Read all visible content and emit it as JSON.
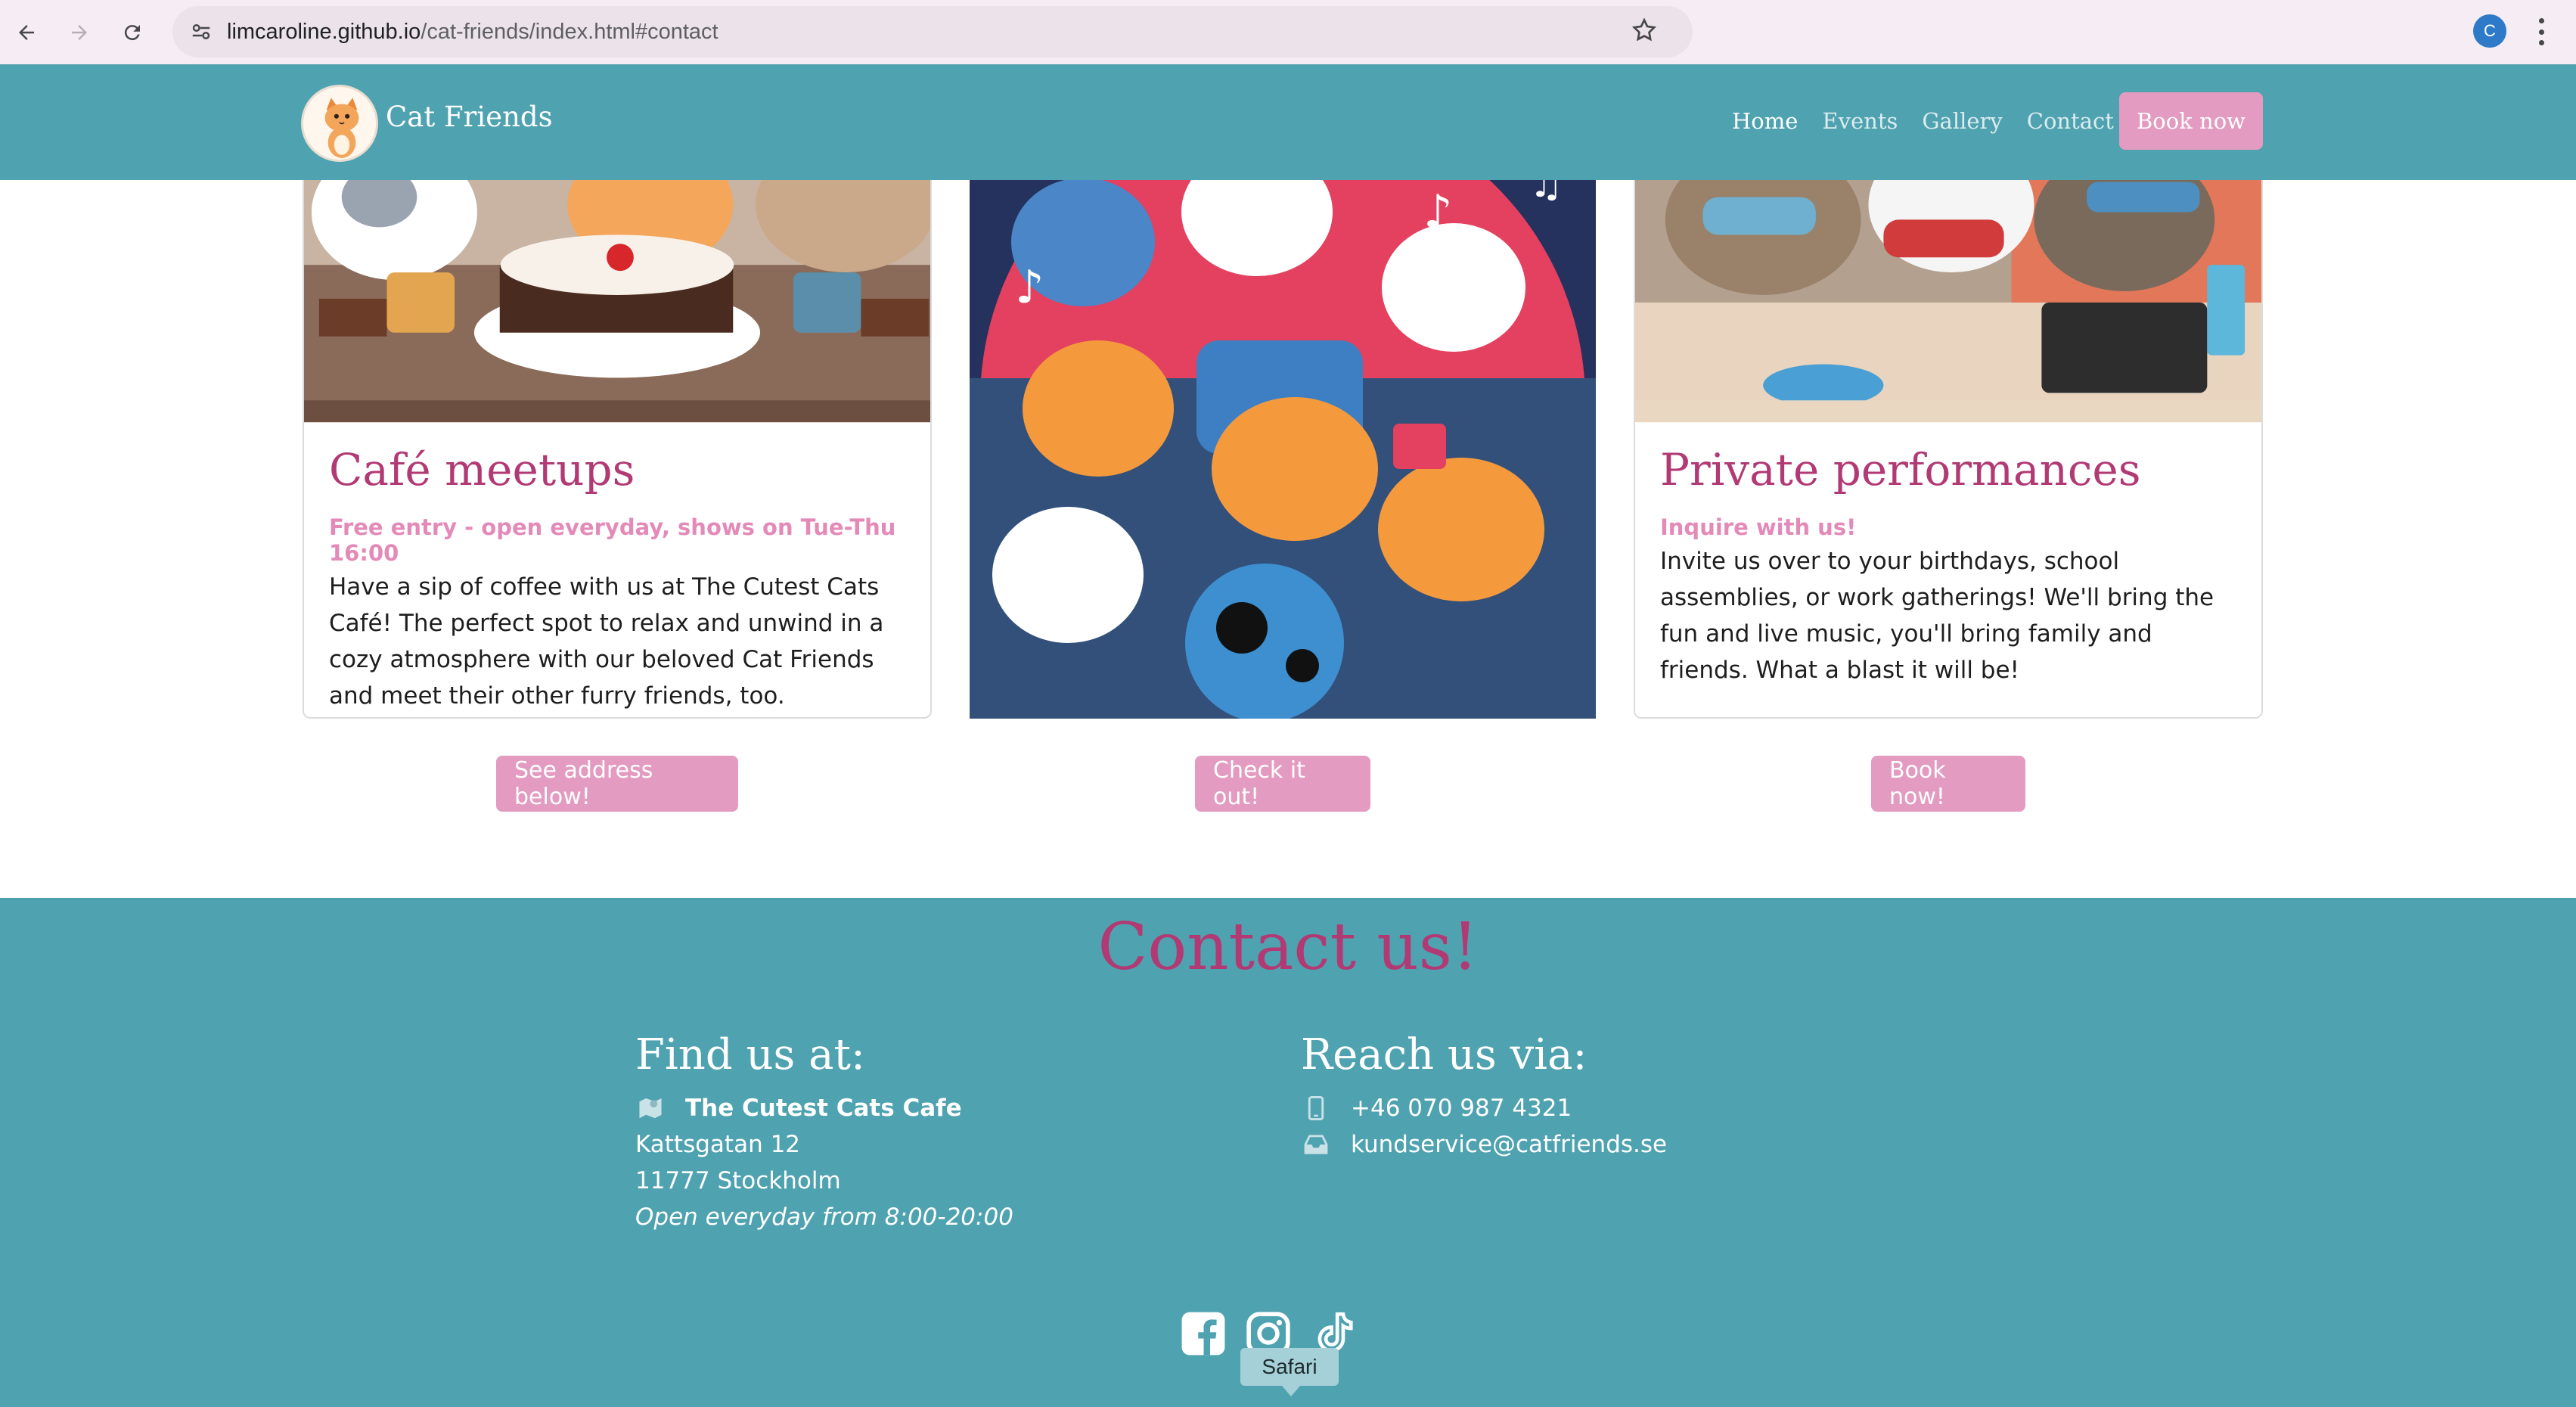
{
  "browser": {
    "url_host": "limcaroline.github.io",
    "url_path": "/cat-friends/index.html#contact",
    "profile_initial": "C"
  },
  "header": {
    "brand": "Cat Friends",
    "nav": [
      "Home",
      "Events",
      "Gallery",
      "Contact"
    ],
    "active_nav": "Home",
    "book_label": "Book now"
  },
  "cards": [
    {
      "title": "Café meetups",
      "subtitle": "Free entry - open everyday, shows on Tue-Thu 16:00",
      "text": "Have a sip of coffee with us at The Cutest Cats Café! The perfect spot to relax and unwind in a cozy atmosphere with our beloved Cat Friends and meet their other furry friends, too.",
      "button": "See address below!"
    },
    {
      "button": "Check it out!"
    },
    {
      "title": "Private performances",
      "subtitle": "Inquire with us!",
      "text": "Invite us over to your birthdays, school assemblies, or work gatherings! We'll bring the fun and live music, you'll bring family and friends. What a blast it will be!",
      "button": "Book now!"
    }
  ],
  "contact": {
    "title": "Contact us!",
    "find": {
      "heading": "Find us at:",
      "name": "The Cutest Cats Cafe",
      "street": "Kattsgatan 12",
      "city": "11777 Stockholm",
      "hours": "Open everyday from 8:00-20:00"
    },
    "reach": {
      "heading": "Reach us via:",
      "phone": "+46 070 987 4321",
      "email": "kundservice@catfriends.se"
    },
    "socials": [
      "facebook-icon",
      "instagram-icon",
      "tiktok-icon"
    ]
  },
  "tooltip": "Safari",
  "colors": {
    "teal": "#4fa2b0",
    "pink": "#e39bc1",
    "title_magenta": "#b23a74"
  }
}
